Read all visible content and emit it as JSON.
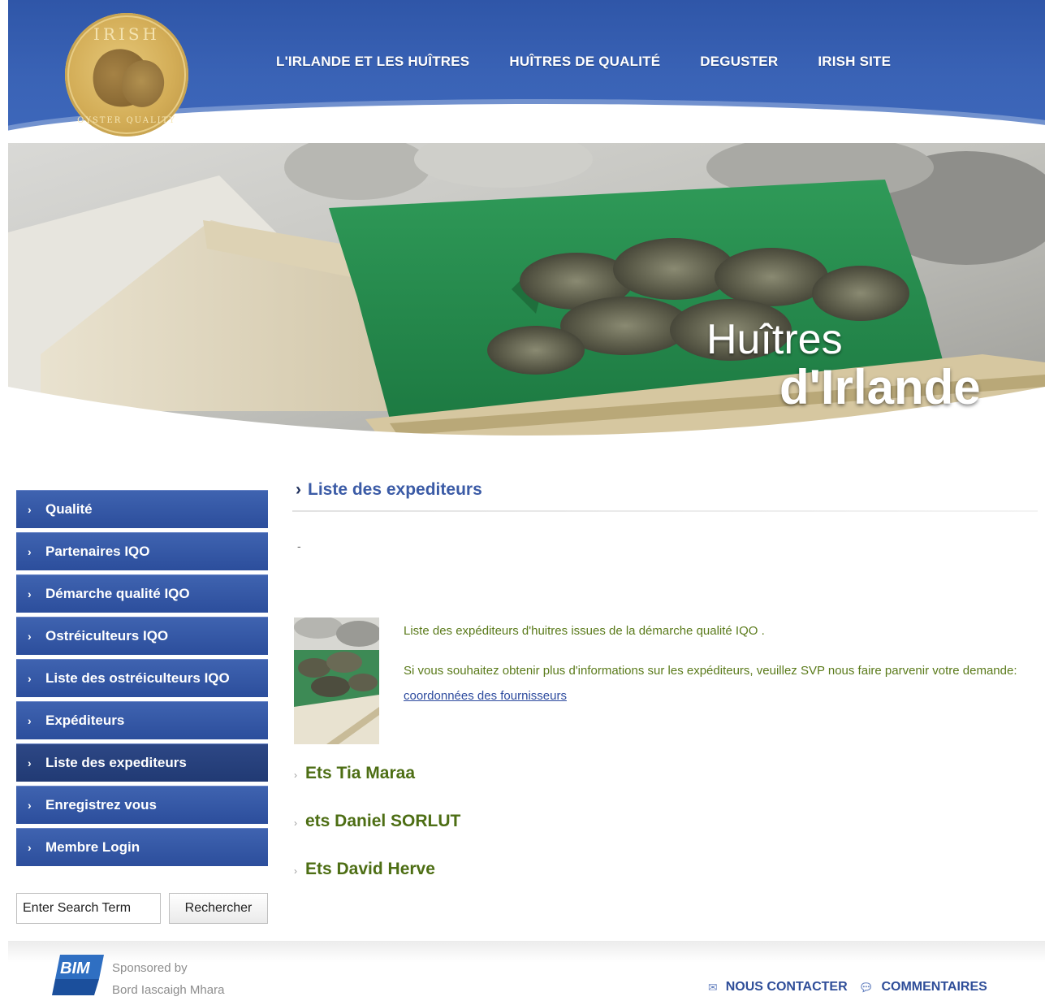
{
  "header": {
    "logo": {
      "top_text": "IRISH",
      "bottom_text": "OYSTER QUALITY"
    },
    "nav": [
      "L'IRLANDE ET LES HUÎTRES",
      "HUÎTRES DE QUALITÉ",
      "DEGUSTER",
      "IRISH SITE"
    ]
  },
  "hero": {
    "title_line1": "Huîtres",
    "title_line2": "d'Irlande"
  },
  "sidebar": {
    "items": [
      "Qualité",
      "Partenaires IQO",
      "Démarche qualité IQO",
      "Ostréiculteurs IQO",
      "Liste des ostréiculteurs IQO",
      "Expéditeurs",
      "Liste des expediteurs",
      "Enregistrez vous",
      "Membre Login"
    ],
    "active_index": 6
  },
  "search": {
    "value": "Enter Search Term",
    "button_label": "Rechercher"
  },
  "main": {
    "title": "Liste des expediteurs",
    "dash": "-",
    "intro_line": "Liste des expéditeurs d'huitres issues de la démarche qualité IQO .",
    "contact_text": "Si vous souhaitez obtenir plus d'informations sur les expéditeurs, veuillez SVP nous faire parvenir votre demande:",
    "contact_link": "coordonnées des fournisseurs",
    "suppliers": [
      "Ets Tia Maraa",
      "ets Daniel SORLUT",
      "Ets David Herve"
    ]
  },
  "footer": {
    "bim_logo_text": "BIM",
    "sponsor_line1": "Sponsored by",
    "sponsor_line2": "Bord Iascaigh Mhara",
    "contact_label": "NOUS CONTACTER",
    "comments_label": "COMMENTAIRES"
  },
  "colors": {
    "header_blue": "#3a63b6",
    "sidebar_blue": "#2c4e9c",
    "sidebar_active": "#213a74",
    "supplier_green": "#4d6e14",
    "link_blue": "#2d4b9e"
  },
  "icons": {
    "contact": "envelope-icon",
    "comments": "speech-bubble-icon",
    "chevron": "chevron-right-icon"
  }
}
